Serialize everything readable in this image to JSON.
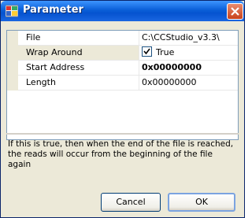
{
  "window": {
    "title": "Parameter"
  },
  "properties": [
    {
      "name": "File",
      "value": "C:\\CCStudio_v3.3\\"
    },
    {
      "name": "Wrap Around",
      "value": "True",
      "checked": true
    },
    {
      "name": "Start Address",
      "value": "0x00000000",
      "bold": true
    },
    {
      "name": "Length",
      "value": "0x00000000"
    }
  ],
  "description": "If this is true, then when the end of the file is reached, the reads will occur from the beginning of the file again",
  "buttons": {
    "cancel_label": "Cancel",
    "ok_label": "OK"
  },
  "colors": {
    "titlebar": "#0a5fd8",
    "close": "#c8421c",
    "face": "#ece9d8"
  },
  "icons": {
    "title": "app-icon",
    "close": "close-icon",
    "check": "checkmark-icon"
  }
}
